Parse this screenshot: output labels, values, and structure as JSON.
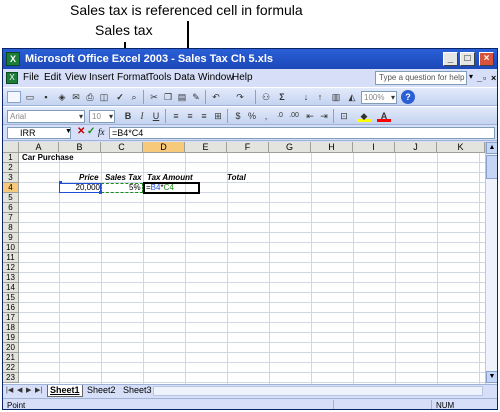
{
  "callouts": {
    "top": "Sales tax is referenced cell in formula",
    "second": "Sales tax"
  },
  "window": {
    "app_icon": "excel-icon",
    "title": "Microsoft Office Excel 2003 - Sales Tax Ch 5.xls",
    "controls": [
      "minimize",
      "maximize",
      "close"
    ]
  },
  "menubar": {
    "items": [
      "File",
      "Edit",
      "View",
      "Insert",
      "Format",
      "Tools",
      "Data",
      "Window",
      "Help"
    ],
    "help_placeholder": "Type a question for help"
  },
  "toolbar": {
    "zoom": "100%",
    "font_name": "Arial",
    "font_size": "10",
    "icons": [
      "new-icon",
      "open-icon",
      "save-icon",
      "permission-icon",
      "email-icon",
      "print-icon",
      "print-preview-icon",
      "spelling-icon",
      "research-icon",
      "cut-icon",
      "copy-icon",
      "paste-icon",
      "format-painter-icon",
      "undo-icon",
      "redo-icon",
      "hyperlink-icon",
      "autosum-icon",
      "sort-ascending-icon",
      "sort-descending-icon",
      "chart-wizard-icon",
      "drawing-icon",
      "zoom-icon",
      "help-icon"
    ],
    "format_icons": [
      "bold-icon",
      "italic-icon",
      "underline-icon",
      "align-left-icon",
      "center-icon",
      "align-right-icon",
      "merge-center-icon",
      "currency-icon",
      "percent-icon",
      "comma-icon",
      "increase-decimal-icon",
      "decrease-decimal-icon",
      "decrease-indent-icon",
      "increase-indent-icon",
      "borders-icon",
      "fill-color-icon",
      "font-color-icon"
    ]
  },
  "formula_bar": {
    "name_box": "IRR",
    "formula": "=B4*C4"
  },
  "sheet": {
    "columns": [
      "A",
      "B",
      "C",
      "D",
      "E",
      "F",
      "G",
      "H",
      "I",
      "J",
      "K"
    ],
    "selected_column": "D",
    "rows": [
      "1",
      "2",
      "3",
      "4",
      "5",
      "6",
      "7",
      "8",
      "9",
      "10",
      "11",
      "12",
      "13",
      "14",
      "15",
      "16",
      "17",
      "18",
      "19",
      "20",
      "21",
      "22",
      "23"
    ],
    "selected_row": "4",
    "cells": {
      "a1": "Car Purchase",
      "b3": "Price",
      "c3": "Sales Tax",
      "d3": "Tax Amount",
      "e3": "Total",
      "b4": "20,000",
      "c4": "5%",
      "d4_prefix": "=",
      "d4_ref1": "B4",
      "d4_op": "*",
      "d4_ref2": "C4"
    },
    "ref_colors": {
      "b4": "#1f4fd8",
      "c4": "#1a8a1a"
    }
  },
  "tabs": {
    "sheets": [
      "Sheet1",
      "Sheet2",
      "Sheet3"
    ],
    "active": "Sheet1"
  },
  "status": {
    "mode": "Point",
    "num": "NUM"
  }
}
